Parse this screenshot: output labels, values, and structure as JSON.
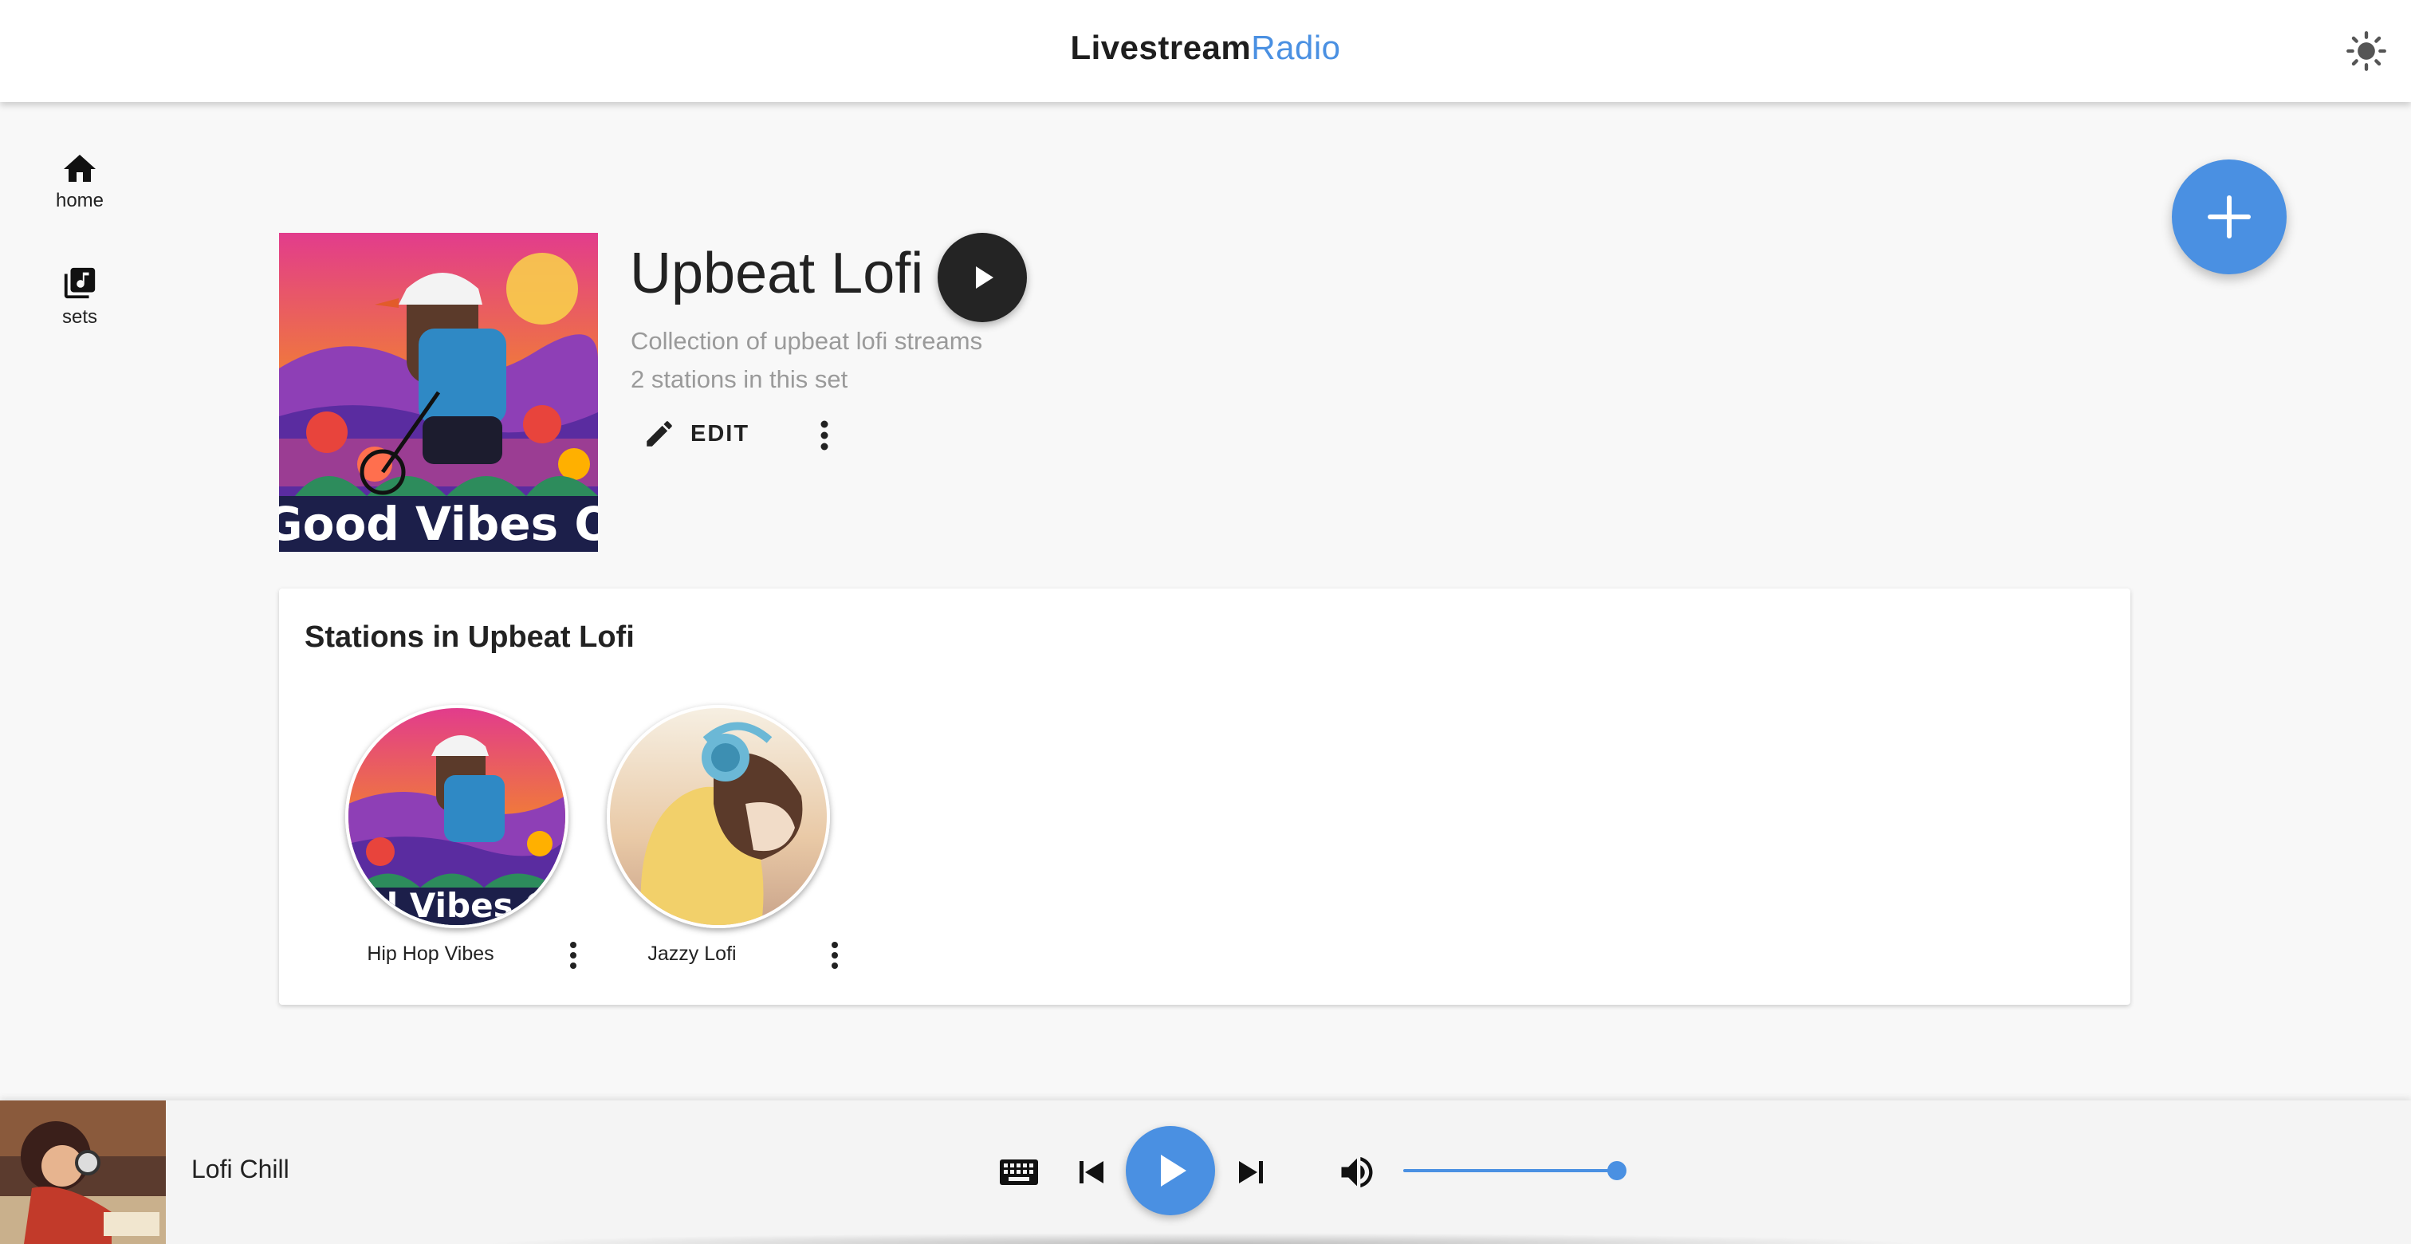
{
  "header": {
    "brand_part1": "Livestream",
    "brand_part2": "Radio",
    "theme_toggle_icon": "sun-icon"
  },
  "sidebar": {
    "items": [
      {
        "label": "home",
        "icon": "home-icon"
      },
      {
        "label": "sets",
        "icon": "library-music-icon"
      }
    ]
  },
  "fab": {
    "icon": "plus-icon"
  },
  "set": {
    "title": "Upbeat Lofi",
    "description": "Collection of upbeat lofi streams",
    "station_count_text": "2 stations in this set",
    "edit_label": "EDIT",
    "cover_text": "Good Vibes Only"
  },
  "stations_card": {
    "title": "Stations in Upbeat Lofi",
    "stations": [
      {
        "name": "Hip Hop Vibes"
      },
      {
        "name": "Jazzy Lofi"
      }
    ]
  },
  "player": {
    "now_playing": "Lofi Chill",
    "volume_level": 1.0
  },
  "colors": {
    "accent": "#4a90e2",
    "dark_button": "#242424",
    "background": "#f8f8f8"
  }
}
